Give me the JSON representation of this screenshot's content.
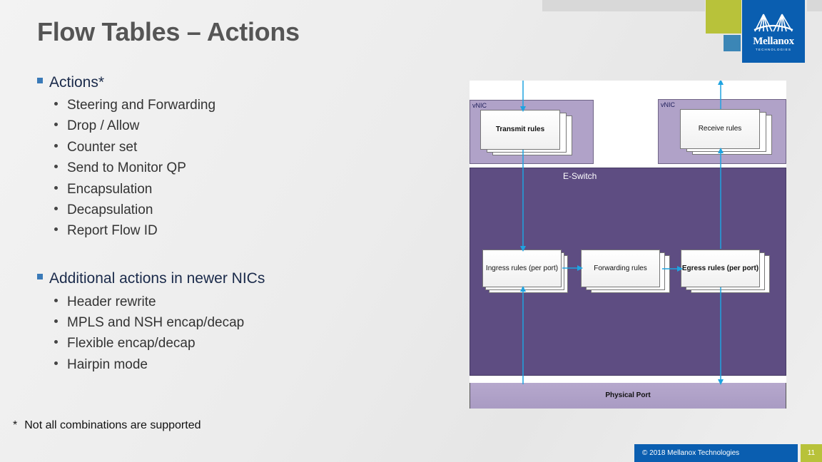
{
  "slide": {
    "title": "Flow Tables – Actions",
    "sections": [
      {
        "heading": "Actions*",
        "items": [
          "Steering and Forwarding",
          "Drop / Allow",
          "Counter set",
          "Send to Monitor QP",
          "Encapsulation",
          "Decapsulation",
          "Report Flow ID"
        ]
      },
      {
        "heading": "Additional actions in newer NICs",
        "items": [
          "Header rewrite",
          "MPLS and NSH encap/decap",
          "Flexible encap/decap",
          "Hairpin mode"
        ]
      }
    ],
    "footnote_marker": "*",
    "footnote": "Not all combinations are supported"
  },
  "logo": {
    "brand": "Mellanox",
    "sub": "TECHNOLOGIES"
  },
  "diagram": {
    "vnic_left_label": "vNIC",
    "vnic_right_label": "vNIC",
    "transmit_rules": "Transmit rules",
    "receive_rules": "Receive rules",
    "eswitch_label": "E-Switch",
    "ingress_rules": "Ingress rules (per port)",
    "forwarding_rules": "Forwarding rules",
    "egress_rules": "Egress rules (per port)",
    "physical_port": "Physical Port"
  },
  "footer": {
    "copyright": "© 2018 Mellanox Technologies",
    "page_number": "11"
  },
  "colors": {
    "brand_blue": "#0a5eb0",
    "accent_green": "#b8c23a",
    "accent_teal": "#3b86b6",
    "eswitch_purple": "#5e4d82",
    "vnic_lavender": "#b0a2c8",
    "arrow_blue": "#1fa3e0"
  }
}
